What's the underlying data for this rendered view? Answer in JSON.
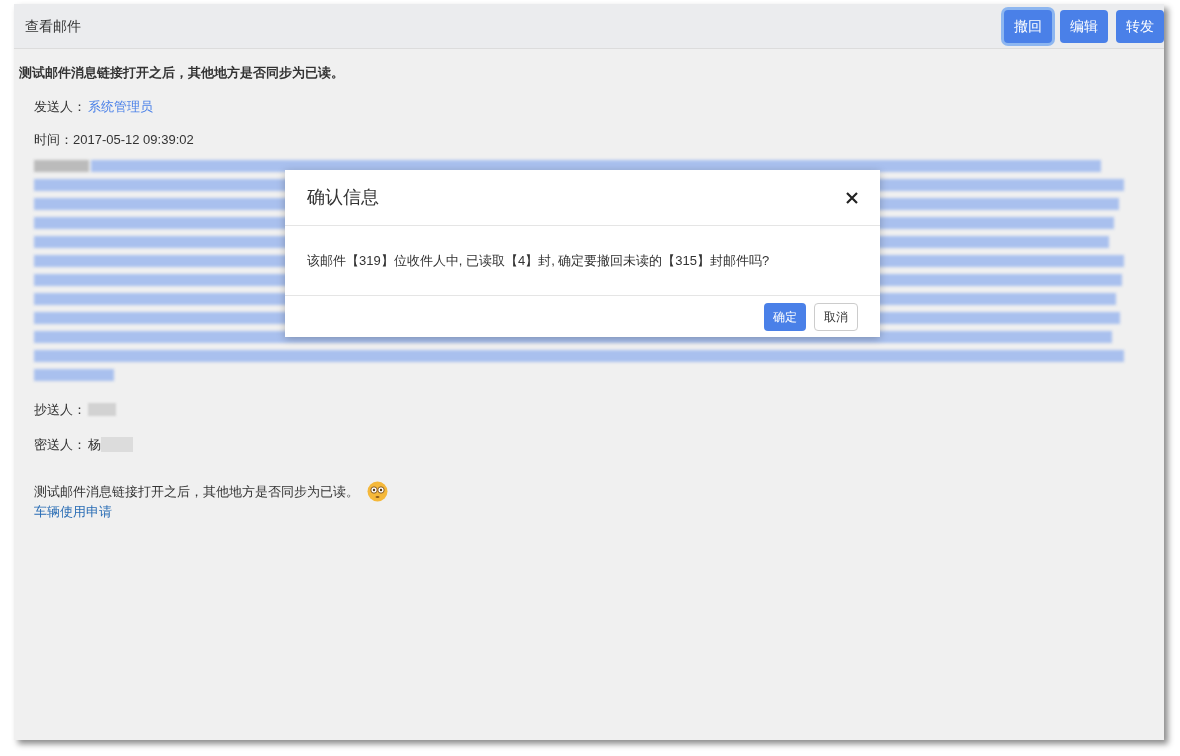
{
  "header": {
    "title": "查看邮件",
    "buttons": [
      {
        "label": "撤回",
        "focused": true
      },
      {
        "label": "编辑",
        "focused": false
      },
      {
        "label": "转发",
        "focused": false
      }
    ]
  },
  "mail": {
    "subject": "测试邮件消息链接打开之后，其他地方是否同步为已读。",
    "sender_label": "发送人：",
    "sender": "系统管理员",
    "time": "时间：2017-05-12 09:39:02",
    "cc_label": "抄送人：",
    "bcc_label": "密送人：",
    "bcc_visible": "杨",
    "body": "测试邮件消息链接打开之后，其他地方是否同步为已读。",
    "link": "车辆使用申请"
  },
  "dialog": {
    "title": "确认信息",
    "message": "该邮件【319】位收件人中, 已读取【4】封, 确定要撤回未读的【315】封邮件吗?",
    "buttons": [
      {
        "label": "确定",
        "kind": "primary"
      },
      {
        "label": "取消",
        "kind": "default"
      }
    ]
  }
}
